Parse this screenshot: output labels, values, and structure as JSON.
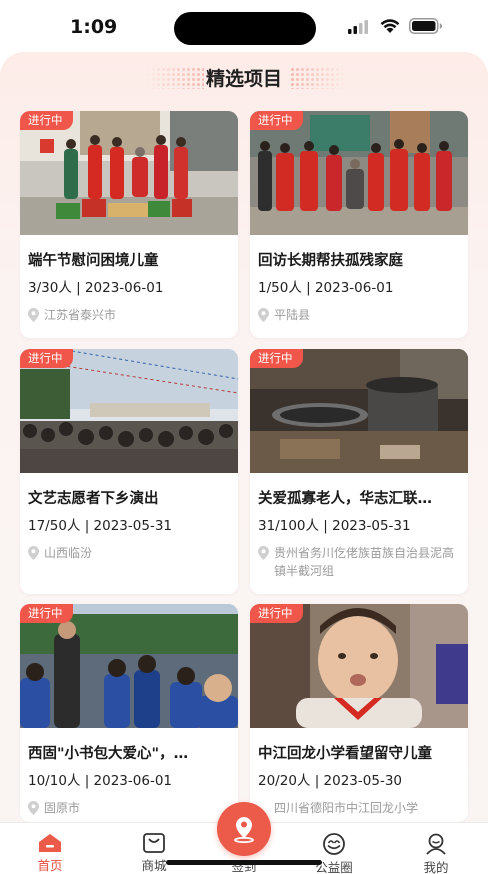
{
  "status_bar": {
    "time": "1:09"
  },
  "section": {
    "title": "精选项目"
  },
  "colors": {
    "accent": "#f0574a",
    "background": "#fdece8",
    "muted": "#9b9b9b"
  },
  "projects": [
    {
      "badge": "进行中",
      "title": "端午节慰问困境儿童",
      "meta": "3/30人 | 2023-06-01",
      "location": "江苏省泰兴市"
    },
    {
      "badge": "进行中",
      "title": "回访长期帮扶孤残家庭",
      "meta": "1/50人 | 2023-06-01",
      "location": "平陆县"
    },
    {
      "badge": "进行中",
      "title": "文艺志愿者下乡演出",
      "meta": "17/50人 | 2023-05-31",
      "location": "山西临汾"
    },
    {
      "badge": "进行中",
      "title": "关爱孤寡老人，华志汇联…",
      "meta": "31/100人 | 2023-05-31",
      "location": "贵州省务川仡佬族苗族自治县泥高镇半截河组"
    },
    {
      "badge": "进行中",
      "title": "西固\"小书包大爱心\"，…",
      "meta": "10/10人 | 2023-06-01",
      "location": "固原市"
    },
    {
      "badge": "进行中",
      "title": "中江回龙小学看望留守儿童",
      "meta": "20/20人 | 2023-05-30",
      "location": "四川省德阳市中江回龙小学"
    }
  ],
  "tabbar": {
    "home": "首页",
    "mall": "商城",
    "checkin": "签到",
    "charity": "公益圈",
    "mine": "我的"
  }
}
